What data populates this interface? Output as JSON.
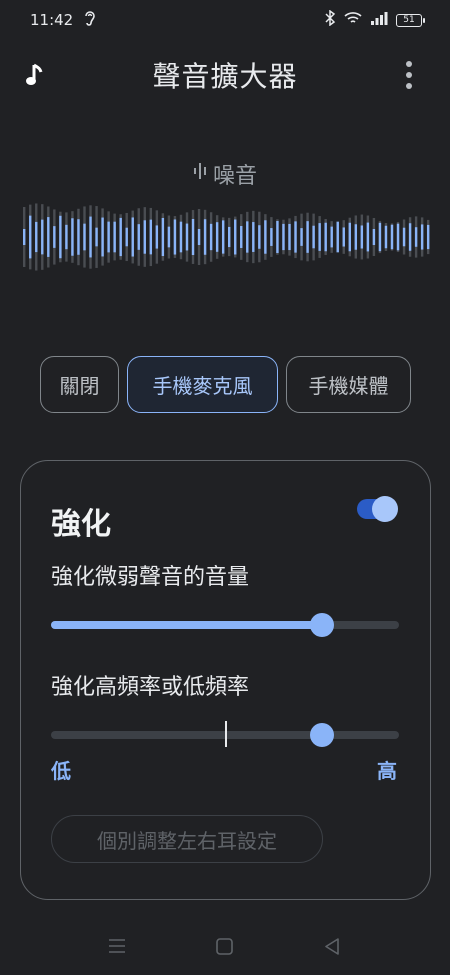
{
  "status_bar": {
    "time": "11:42",
    "battery": "51"
  },
  "app_bar": {
    "title": "聲音擴大器"
  },
  "noise": {
    "label": "噪音"
  },
  "modes": [
    {
      "label": "關閉",
      "selected": false
    },
    {
      "label": "手機麥克風",
      "selected": true
    },
    {
      "label": "手機媒體",
      "selected": false
    }
  ],
  "enhance_card": {
    "title": "強化",
    "toggle_on": true,
    "volume_label": "強化微弱聲音的音量",
    "volume_level": 0.78,
    "frequency_label": "強化高頻率或低頻率",
    "frequency_level": 0.78,
    "frequency_low": "低",
    "frequency_high": "高",
    "ear_button": "個別調整左右耳設定"
  },
  "colors": {
    "accent": "#8ab4f8",
    "background": "#202124"
  }
}
